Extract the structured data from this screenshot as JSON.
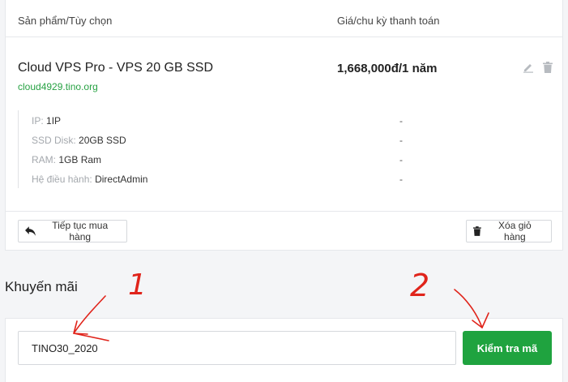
{
  "cart": {
    "header": {
      "product_col": "Sản phẩm/Tùy chọn",
      "price_col": "Giá/chu kỳ thanh toán"
    },
    "item": {
      "name": "Cloud VPS Pro - VPS 20 GB SSD",
      "domain": "cloud4929.tino.org",
      "price": "1,668,000đ/1 năm",
      "config": [
        {
          "label": "IP:",
          "value": "1IP",
          "price": "-"
        },
        {
          "label": "SSD Disk:",
          "value": "20GB SSD",
          "price": "-"
        },
        {
          "label": "RAM:",
          "value": "1GB Ram",
          "price": "-"
        },
        {
          "label": "Hệ điều hành:",
          "value": "DirectAdmin",
          "price": "-"
        }
      ]
    },
    "continue_label": "Tiếp tục mua hàng",
    "clear_label": "Xóa giỏ hàng"
  },
  "promo": {
    "title": "Khuyến mãi",
    "code_value": "TINO30_2020",
    "check_label": "Kiểm tra mã"
  },
  "annotations": {
    "step1": "1",
    "step2": "2",
    "color": "#e0241b"
  },
  "colors": {
    "accent_green": "#1fa33f",
    "domain_green": "#27a243"
  }
}
